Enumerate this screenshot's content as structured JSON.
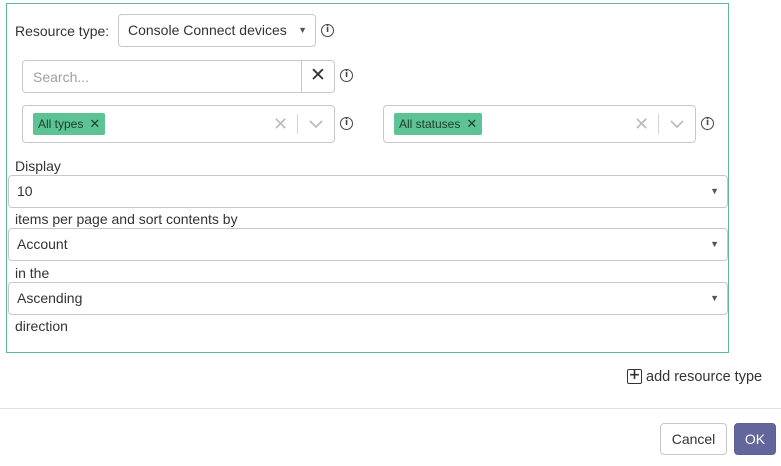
{
  "resource": {
    "label": "Resource type:",
    "selected": "Console Connect devices"
  },
  "search": {
    "placeholder": "Search...",
    "value": "",
    "clear_symbol": "✕"
  },
  "type_filter": {
    "chips": [
      "All types"
    ]
  },
  "status_filter": {
    "chips": [
      "All statuses"
    ]
  },
  "display": {
    "display_label": "Display",
    "per_page_value": "10",
    "per_page_suffix": "items per page and sort contents by",
    "sort_by_value": "Account",
    "in_the_label": "in the",
    "direction_value": "Ascending",
    "direction_label": "direction"
  },
  "add_resource": {
    "label": "add resource type"
  },
  "buttons": {
    "cancel": "Cancel",
    "ok": "OK"
  },
  "colors": {
    "panel_border": "#5fb89a",
    "chip_bg": "#5cc494",
    "ok_bg": "#62669a"
  },
  "icons": {
    "info": "info-circle-icon",
    "caret": "caret-down-icon",
    "clear": "close-icon",
    "chevron": "chevron-down-icon",
    "add": "plus-square-icon"
  }
}
